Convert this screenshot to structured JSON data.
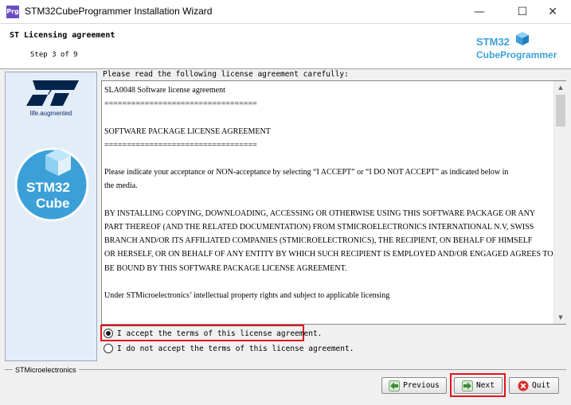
{
  "window": {
    "app_icon_text": "Prg",
    "title": "STM32CubeProgrammer Installation Wizard",
    "minimize": "—",
    "maximize": "☐",
    "close": "✕"
  },
  "header": {
    "title": "ST Licensing agreement",
    "step": "Step 3 of 9",
    "logo_line1": "STM32",
    "logo_line2": "CubeProgrammer"
  },
  "left_panel": {
    "st_tagline": "life.augmented",
    "badge_line1": "STM32",
    "badge_line2": "Cube"
  },
  "main": {
    "intro": "Please read the following license agreement carefully:",
    "license_text": "SLA0048 Software license agreement\n==================================\n\nSOFTWARE PACKAGE LICENSE AGREEMENT\n==================================\n\nPlease indicate your acceptance or NON-acceptance by selecting “I ACCEPT” or “I DO NOT ACCEPT” as indicated below in\nthe media.\n\nBY INSTALLING COPYING, DOWNLOADING, ACCESSING OR OTHERWISE USING THIS SOFTWARE PACKAGE OR ANY PART THEREOF (AND THE RELATED DOCUMENTATION) FROM STMICROELECTRONICS INTERNATIONAL N.V, SWISS BRANCH AND/OR ITS AFFILIATED COMPANIES (STMICROELECTRONICS), THE RECIPIENT, ON BEHALF OF HIMSELF\nOR HERSELF, OR ON BEHALF OF ANY ENTITY BY WHICH SUCH RECIPIENT IS EMPLOYED AND/OR ENGAGED AGREES TO BE BOUND BY THIS SOFTWARE PACKAGE LICENSE AGREEMENT.\n\nUnder STMicroelectronics’ intellectual property rights and subject to applicable licensing",
    "accept_label": "I accept the terms of this license agreement.",
    "decline_label": "I do not accept the terms of this license agreement.",
    "accept_selected": true
  },
  "footer": {
    "vendor": "STMicroelectronics",
    "previous_label": "Previous",
    "next_label": "Next",
    "quit_label": "Quit"
  },
  "colors": {
    "highlight": "#e0161b",
    "st_blue": "#03234b",
    "cube_blue": "#3ca0d8"
  }
}
